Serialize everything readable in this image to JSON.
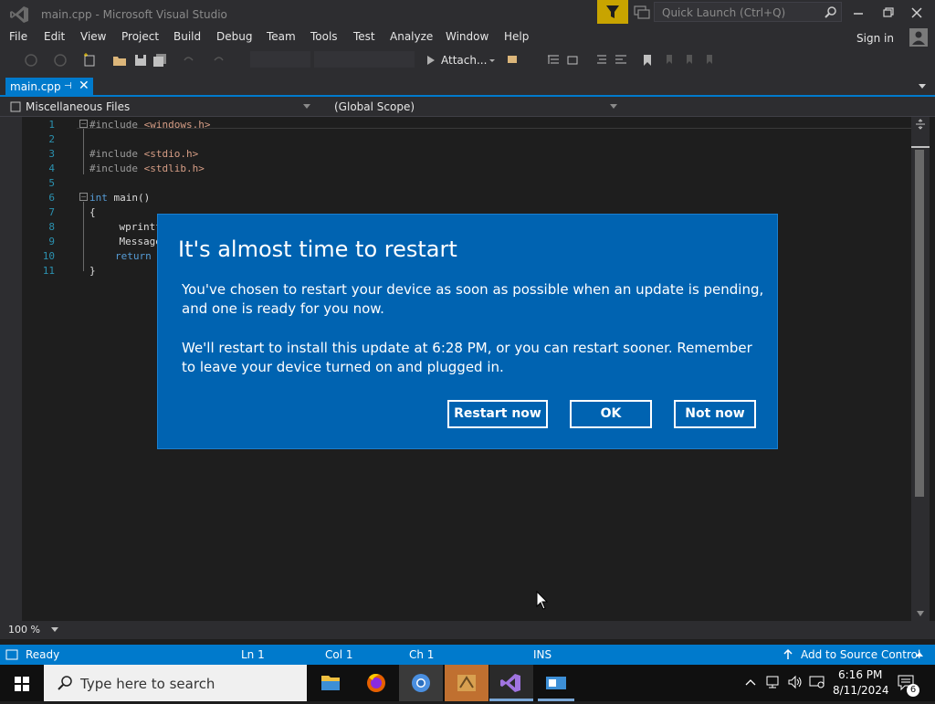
{
  "window": {
    "title": "main.cpp - Microsoft Visual Studio",
    "quick_launch_placeholder": "Quick Launch (Ctrl+Q)"
  },
  "menu": {
    "items": [
      "File",
      "Edit",
      "View",
      "Project",
      "Build",
      "Debug",
      "Team",
      "Tools",
      "Test",
      "Analyze",
      "Window",
      "Help"
    ],
    "sign_in": "Sign in"
  },
  "toolbar": {
    "attach_label": "Attach..."
  },
  "tab": {
    "label": "main.cpp"
  },
  "navbar": {
    "files": "Miscellaneous Files",
    "scope": "(Global Scope)"
  },
  "editor": {
    "line_numbers": [
      "1",
      "2",
      "3",
      "4",
      "5",
      "6",
      "7",
      "8",
      "9",
      "10",
      "11"
    ],
    "lines": {
      "l1_pp": "#include ",
      "l1_str": "<windows.h>",
      "l3_pp": "#include ",
      "l3_str": "<stdio.h>",
      "l4_pp": "#include ",
      "l4_str": "<stdlib.h>",
      "l6_kw": "int",
      "l6_rest": " main()",
      "l7": "{",
      "l8": "    wprintf",
      "l9": "    Message",
      "l10_kw": "return",
      "l11": "}"
    }
  },
  "zoom": "100 %",
  "statusbar": {
    "ready": "Ready",
    "ln": "Ln 1",
    "col": "Col 1",
    "ch": "Ch 1",
    "ins": "INS",
    "source_control": "Add to Source Control"
  },
  "taskbar": {
    "search_placeholder": "Type here to search",
    "time": "6:16 PM",
    "date": "8/11/2024",
    "notification_count": "6"
  },
  "dialog": {
    "title": "It's almost time to restart",
    "para1": "You've chosen to restart your device as soon as possible when an update is pending, and one is ready for you now.",
    "para2": "We'll restart to install this update at 6:28 PM, or you can restart sooner. Remember to leave your device turned on and plugged in.",
    "restart_label": "Restart now",
    "ok_label": "OK",
    "not_now_label": "Not now"
  },
  "colors": {
    "accent": "#007acc",
    "dialog_bg": "#0063b1"
  }
}
